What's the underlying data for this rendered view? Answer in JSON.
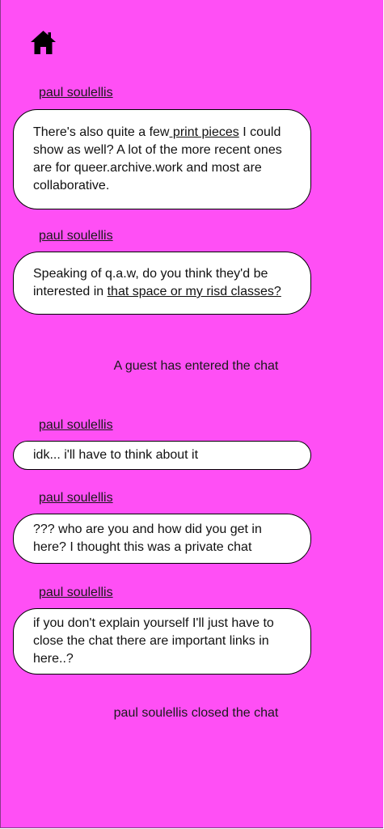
{
  "nav": {
    "home_icon": "home-icon"
  },
  "messages": [
    {
      "sender": "paul soulellis",
      "text_before": "There's also quite a few",
      "link": " print pieces",
      "text_after": " I could show as well? A lot of the more recent ones are for queer.archive.work and most are collaborative."
    },
    {
      "sender": "paul soulellis",
      "text_before": "Speaking of q.a.w, do you think they'd be interested in ",
      "link": " that space or my risd classes?",
      "text_after": ""
    },
    {
      "sender": "paul soulellis",
      "text": "idk... i'll have to think about it"
    },
    {
      "sender": "paul soulellis",
      "text": "??? who are you and how did you get in here? I thought this was a private chat"
    },
    {
      "sender": "paul soulellis",
      "text": "if you don't explain yourself I'll just have to close the chat there are important links in here..?"
    }
  ],
  "system": {
    "guest_entered": "A guest has entered the chat",
    "chat_closed": "paul soulellis closed the chat"
  },
  "colors": {
    "background": "#ff4ff5",
    "bubble": "#ffffff",
    "text": "#111111"
  }
}
